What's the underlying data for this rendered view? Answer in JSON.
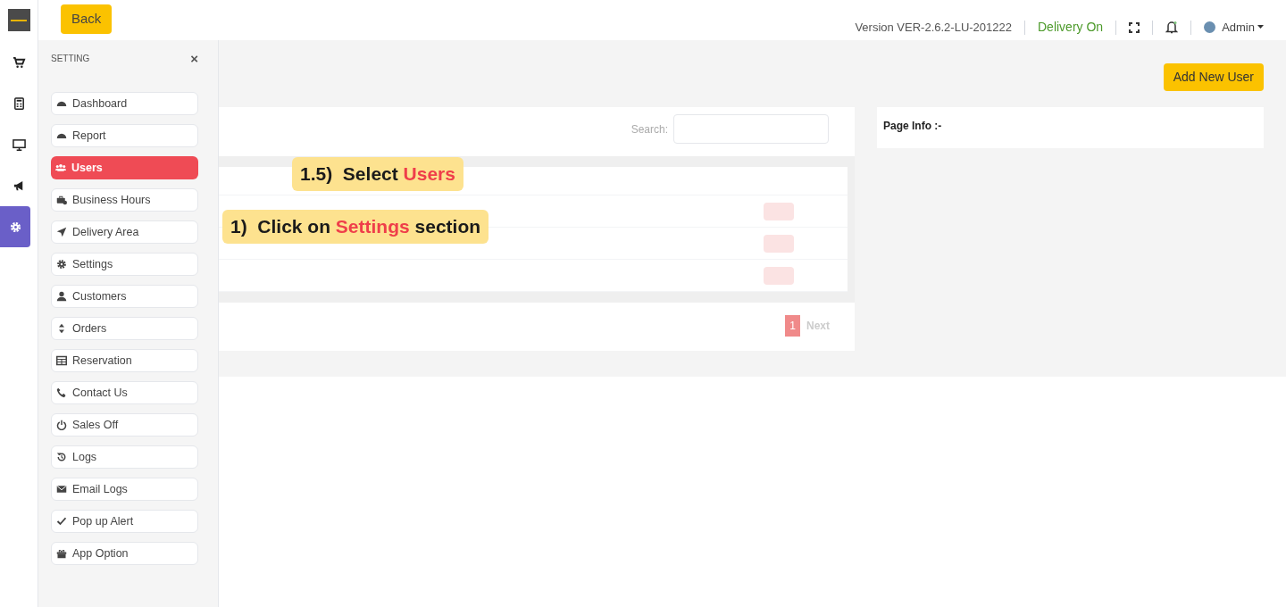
{
  "topbar": {
    "back_button": "Back",
    "version": "Version VER-2.6.2-LU-201222",
    "delivery_status": "Delivery On",
    "user_menu": "Admin"
  },
  "rail": [
    {
      "selected": false
    },
    {
      "selected": false
    },
    {
      "selected": false
    },
    {
      "selected": false
    },
    {
      "selected": true
    }
  ],
  "settings_panel": {
    "title": "SETTING",
    "close": "×",
    "items": [
      {
        "label": "Dashboard",
        "selected": false
      },
      {
        "label": "Report",
        "selected": false
      },
      {
        "label": "Users",
        "selected": true
      },
      {
        "label": "Business Hours",
        "selected": false
      },
      {
        "label": "Delivery Area",
        "selected": false
      },
      {
        "label": "Settings",
        "selected": false
      },
      {
        "label": "Customers",
        "selected": false
      },
      {
        "label": "Orders",
        "selected": false
      },
      {
        "label": "Reservation",
        "selected": false
      },
      {
        "label": "Contact Us",
        "selected": false
      },
      {
        "label": "Sales Off",
        "selected": false
      },
      {
        "label": "Logs",
        "selected": false
      },
      {
        "label": "Email Logs",
        "selected": false
      },
      {
        "label": "Pop up Alert",
        "selected": false
      },
      {
        "label": "App Option",
        "selected": false
      }
    ]
  },
  "page": {
    "add_button": "Add New User",
    "search_label": "Search:",
    "pagination": {
      "page": "1",
      "next": "Next"
    },
    "page_info": "Page Info :-"
  },
  "callouts": [
    {
      "number": "1.5)",
      "text": "Select ",
      "highlight": "Users"
    },
    {
      "number": "1)",
      "text": "Click on ",
      "highlight": "Settings",
      "suffix": " section"
    }
  ]
}
